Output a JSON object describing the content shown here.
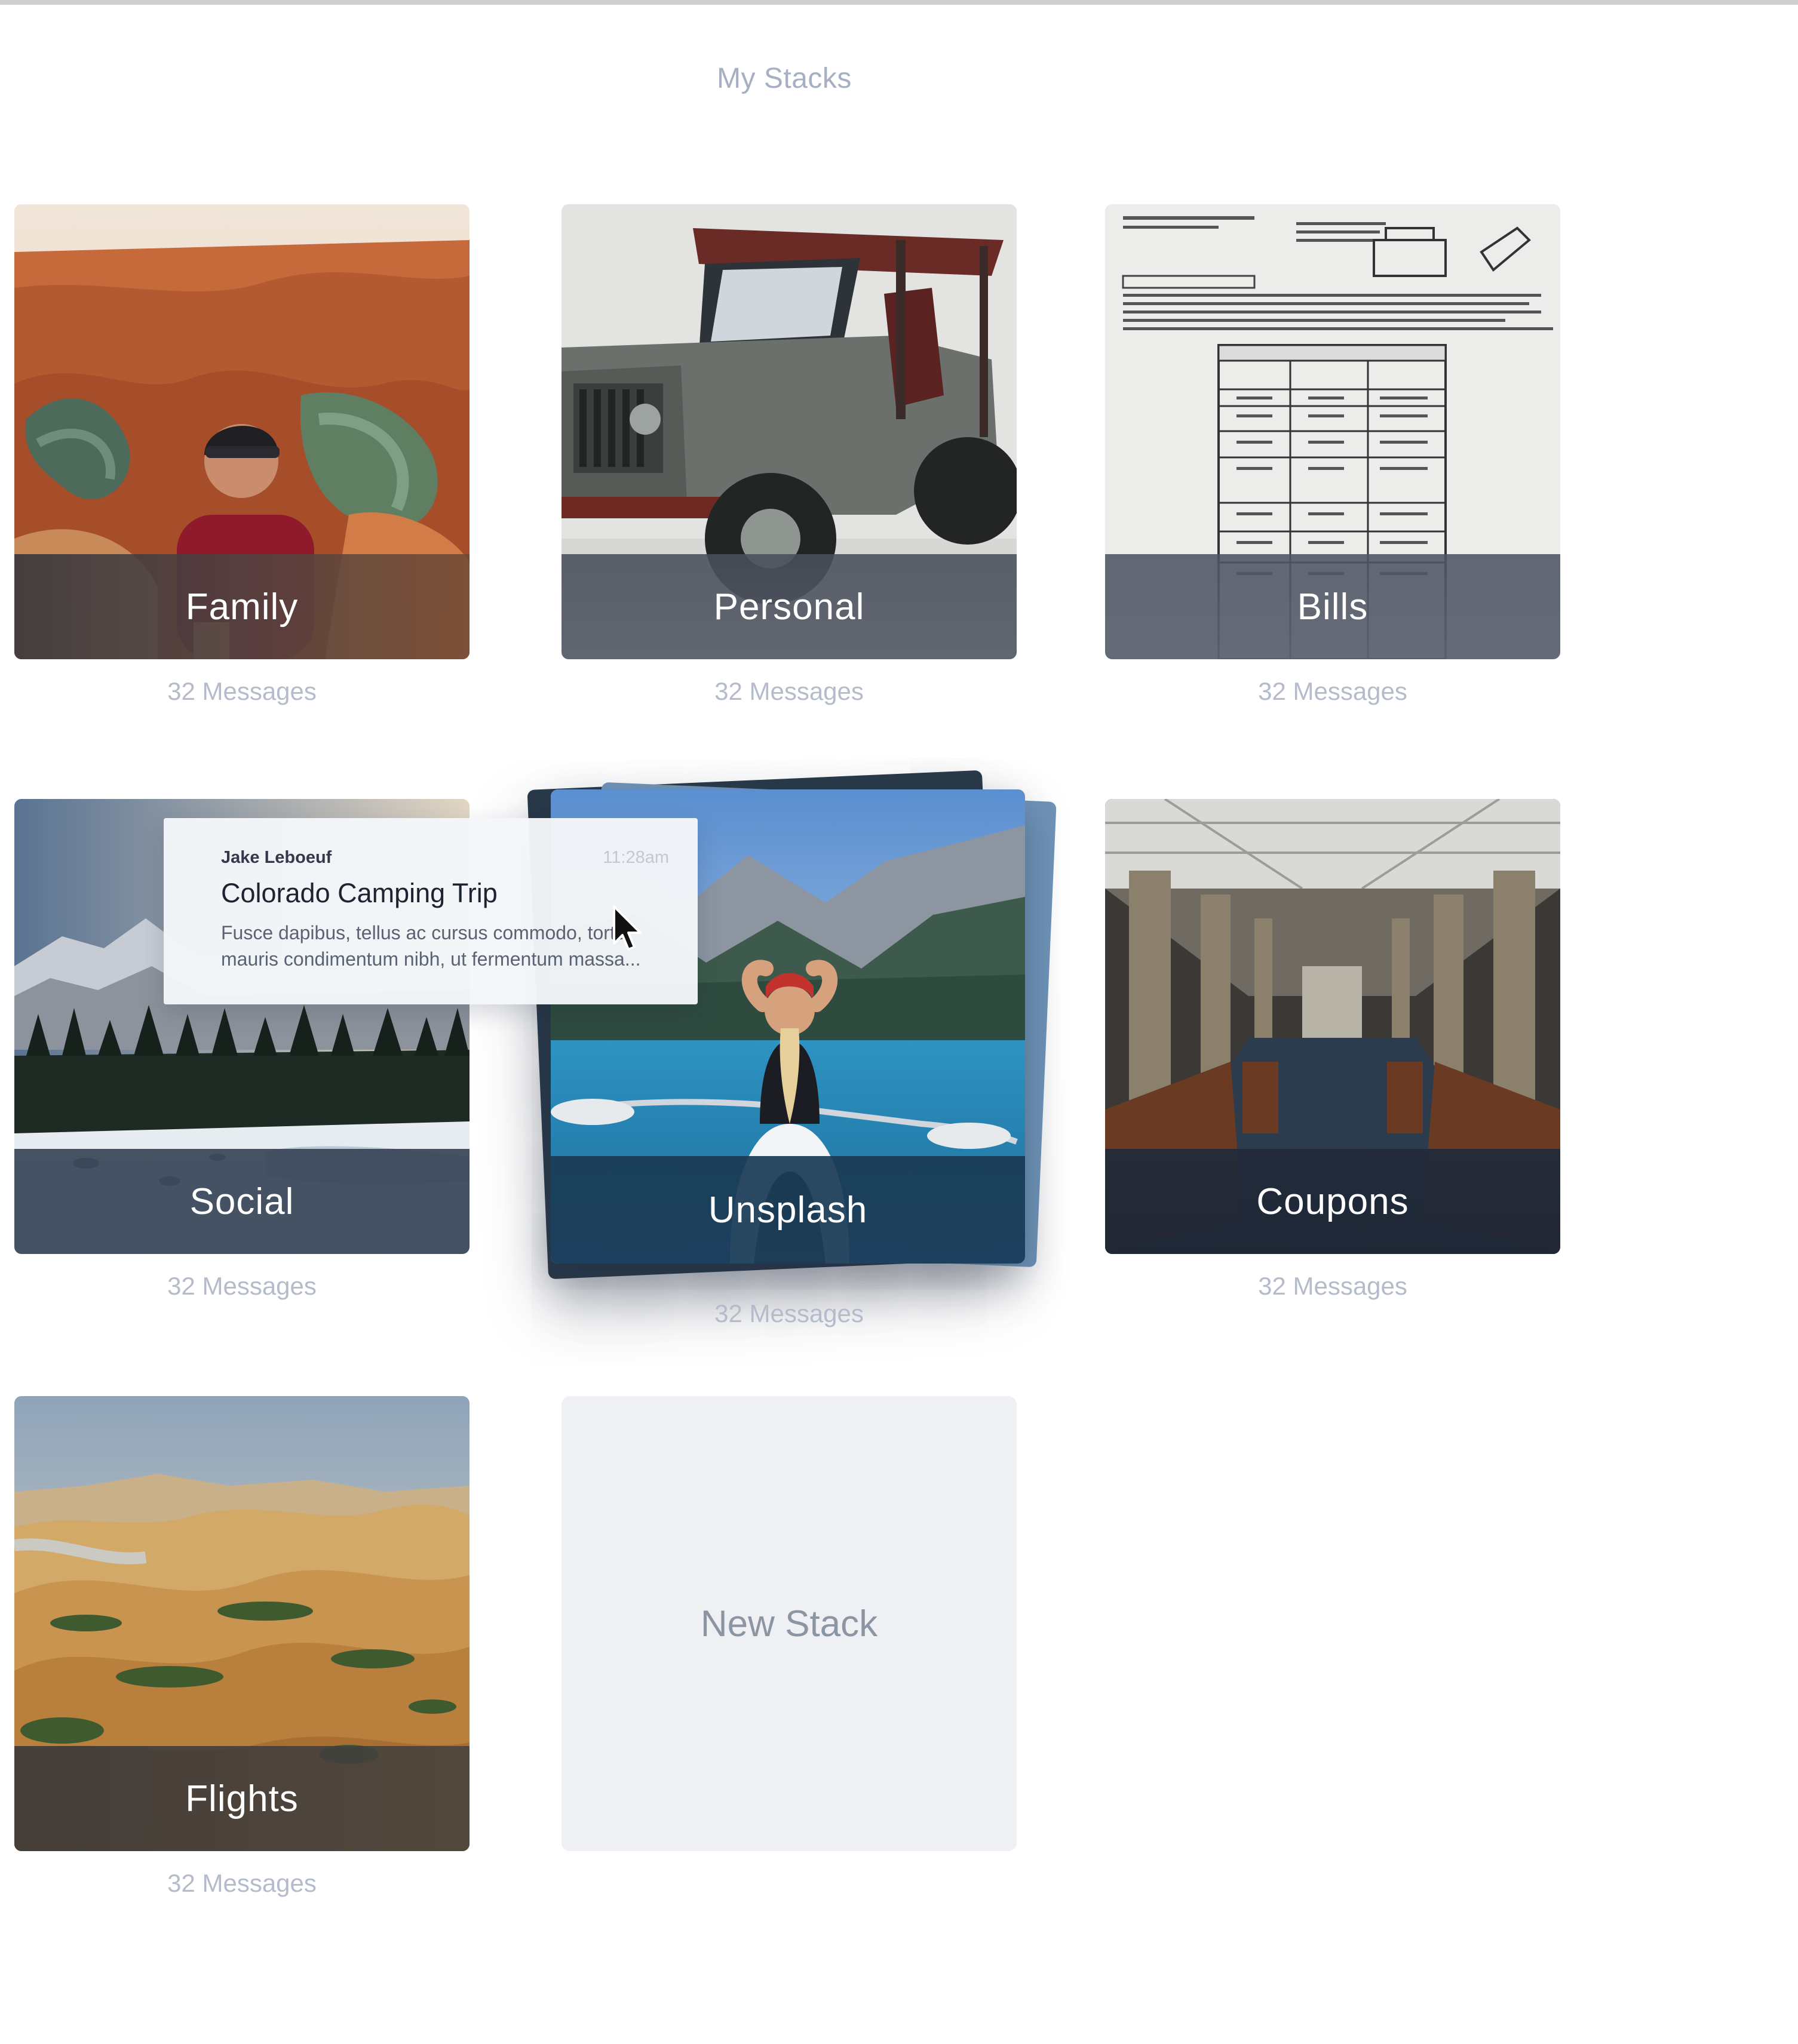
{
  "page": {
    "title": "My Stacks"
  },
  "stacks": [
    {
      "name": "Family",
      "count": "32 Messages"
    },
    {
      "name": "Personal",
      "count": "32 Messages"
    },
    {
      "name": "Bills",
      "count": "32 Messages"
    },
    {
      "name": "Social",
      "count": "32 Messages"
    },
    {
      "name": "Unsplash",
      "count": "32 Messages"
    },
    {
      "name": "Coupons",
      "count": "32 Messages"
    },
    {
      "name": "Flights",
      "count": "32 Messages"
    }
  ],
  "new_stack": {
    "label": "New Stack"
  },
  "dragged_message": {
    "sender": "Jake Leboeuf",
    "time": "11:28am",
    "subject": "Colorado Camping Trip",
    "preview": "Fusce dapibus, tellus ac cursus commodo, tortor mauris condimentum nibh, ut fermentum massa..."
  },
  "icons": {
    "cursor": "mouse-pointer-icon"
  }
}
